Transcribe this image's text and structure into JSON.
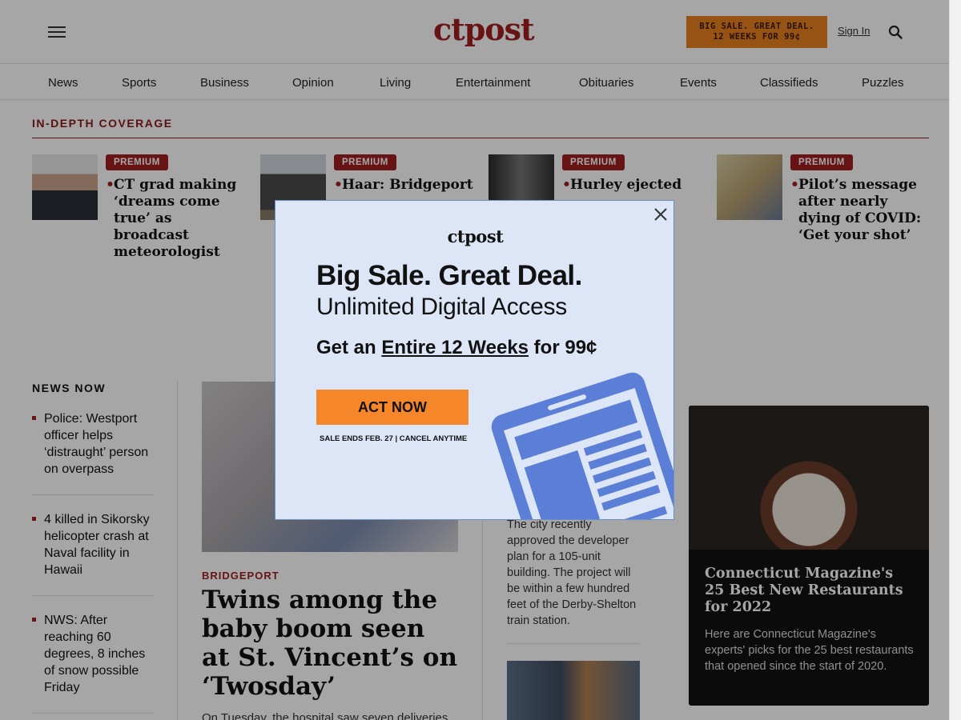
{
  "header": {
    "logo": "ctpost",
    "sale_button_line1": "BIG SALE. GREAT DEAL.",
    "sale_button_line2": "12 WEEKS FOR 99¢",
    "sign_in": "Sign In",
    "menu_icon": "hamburger-menu-icon",
    "search_icon": "search-icon"
  },
  "nav": {
    "items": [
      "News",
      "Sports",
      "Business",
      "Opinion",
      "Living",
      "Entertainment",
      "Obituaries",
      "Events",
      "Classifieds",
      "Puzzles"
    ]
  },
  "in_depth": {
    "label": "IN-DEPTH COVERAGE",
    "cards": [
      {
        "badge": "PREMIUM",
        "title": "CT grad making ‘dreams come true’ as broadcast meteorologist"
      },
      {
        "badge": "PREMIUM",
        "title": "Haar: Bridgeport"
      },
      {
        "badge": "PREMIUM",
        "title": "Hurley ejected"
      },
      {
        "badge": "PREMIUM",
        "title": "Pilot’s message after nearly dying of COVID: ‘Get your shot’"
      }
    ]
  },
  "news_now": {
    "label": "NEWS NOW",
    "items": [
      "Police: Westport officer helps ‘distraught’ person on overpass",
      "4 killed in Sikorsky helicopter crash at Naval facility in Hawaii",
      "NWS: After reaching 60 degrees, 8 inches of snow possible Friday"
    ]
  },
  "main_story": {
    "kicker": "BRIDGEPORT",
    "headline": "Twins among the baby boom seen at St. Vincent’s on ‘Twosday’",
    "dek": "On Tuesday, the hospital saw seven deliveries"
  },
  "mid_story": {
    "dek": "The city recently approved the developer plan for a 105-unit building. The project will be within a few hundred feet of the Derby-Shelton train station."
  },
  "feature": {
    "headline": "Connecticut Magazine's 25 Best New Restaurants for 2022",
    "dek": "Here are Connecticut Magazine's experts' picks for the 25 best restaurants that opened since the start of 2020."
  },
  "modal": {
    "logo": "ctpost",
    "headline": "Big Sale. Great Deal.",
    "subhead": "Unlimited Digital Access",
    "offer_prefix": "Get an ",
    "offer_link": "Entire 12 Weeks",
    "offer_suffix": " for 99¢",
    "cta": "ACT NOW",
    "fine_print": "SALE ENDS FEB. 27 | CANCEL ANYTIME",
    "close_icon": "close-icon",
    "illustration": "tablet-newspaper-icon"
  },
  "colors": {
    "brand_red": "#a02020",
    "sale_orange": "#e8801e",
    "modal_bg": "#dde6f6",
    "cta_orange": "#f5862a",
    "tablet_blue": "#5b7fd6"
  }
}
